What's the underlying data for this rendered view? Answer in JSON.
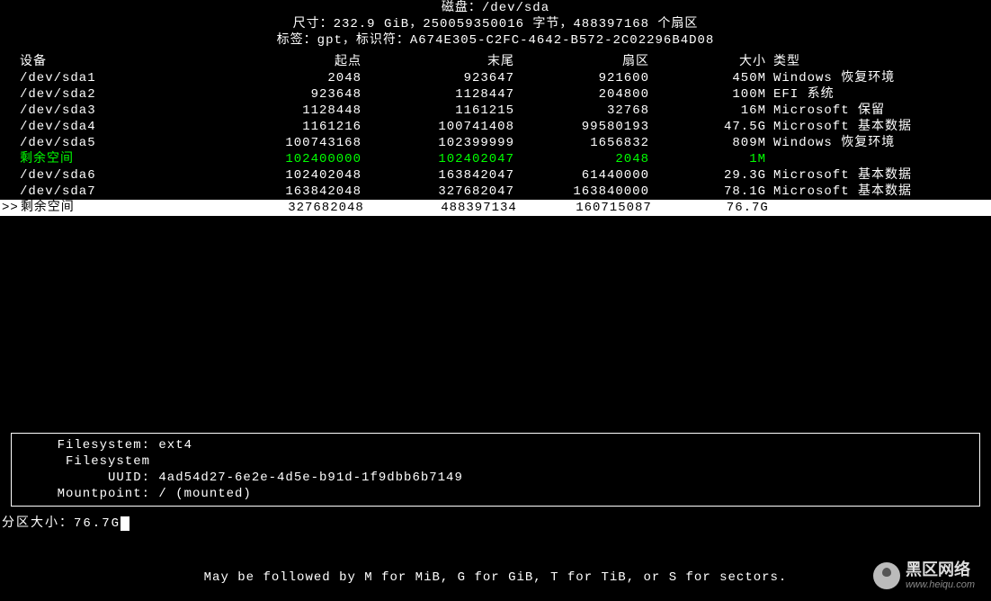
{
  "header": {
    "line1": "磁盘：/dev/sda",
    "line2": "尺寸：232.9 GiB，250059350016 字节，488397168 个扇区",
    "line3": "标签：gpt，标识符：A674E305-C2FC-4642-B572-2C02296B4D08"
  },
  "columns": {
    "device": "设备",
    "start": "起点",
    "end": "末尾",
    "sectors": "扇区",
    "size": "大小",
    "type": "类型"
  },
  "rows": [
    {
      "device": "/dev/sda1",
      "start": "2048",
      "end": "923647",
      "sectors": "921600",
      "size": "450M",
      "type": "Windows 恢复环境",
      "green": false,
      "selected": false
    },
    {
      "device": "/dev/sda2",
      "start": "923648",
      "end": "1128447",
      "sectors": "204800",
      "size": "100M",
      "type": "EFI 系统",
      "green": false,
      "selected": false
    },
    {
      "device": "/dev/sda3",
      "start": "1128448",
      "end": "1161215",
      "sectors": "32768",
      "size": "16M",
      "type": "Microsoft 保留",
      "green": false,
      "selected": false
    },
    {
      "device": "/dev/sda4",
      "start": "1161216",
      "end": "100741408",
      "sectors": "99580193",
      "size": "47.5G",
      "type": "Microsoft 基本数据",
      "green": false,
      "selected": false
    },
    {
      "device": "/dev/sda5",
      "start": "100743168",
      "end": "102399999",
      "sectors": "1656832",
      "size": "809M",
      "type": "Windows 恢复环境",
      "green": false,
      "selected": false
    },
    {
      "device": "剩余空间",
      "start": "102400000",
      "end": "102402047",
      "sectors": "2048",
      "size": "1M",
      "type": "",
      "green": true,
      "selected": false
    },
    {
      "device": "/dev/sda6",
      "start": "102402048",
      "end": "163842047",
      "sectors": "61440000",
      "size": "29.3G",
      "type": "Microsoft 基本数据",
      "green": false,
      "selected": false
    },
    {
      "device": "/dev/sda7",
      "start": "163842048",
      "end": "327682047",
      "sectors": "163840000",
      "size": "78.1G",
      "type": "Microsoft 基本数据",
      "green": false,
      "selected": false
    },
    {
      "device": "剩余空间",
      "start": "327682048",
      "end": "488397134",
      "sectors": "160715087",
      "size": "76.7G",
      "type": "",
      "green": false,
      "selected": true
    }
  ],
  "info": {
    "fs_label": "Filesystem:",
    "fs_value": "ext4",
    "uuid_label": "Filesystem UUID:",
    "uuid_value": "4ad54d27-6e2e-4d5e-b91d-1f9dbb6b7149",
    "mount_label": "Mountpoint:",
    "mount_value": "/ (mounted)"
  },
  "input": {
    "label": "分区大小：",
    "value": "76.7G"
  },
  "hint": "May be followed by M for MiB, G for GiB, T for TiB, or S for sectors.",
  "watermark": {
    "main": "黑区网络",
    "sub": "www.heiqu.com"
  }
}
